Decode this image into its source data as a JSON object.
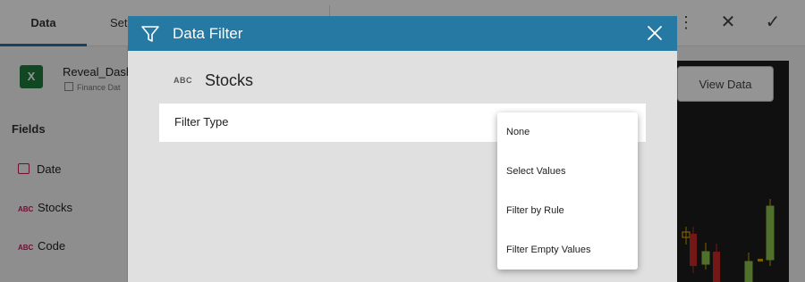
{
  "topbar": {
    "tabs": [
      {
        "label": "Data"
      },
      {
        "label": "Set"
      }
    ]
  },
  "datasource": {
    "name": "Reveal_Dasht",
    "subtitle": "Finance Dat",
    "icon": "excel-icon"
  },
  "fields": {
    "title": "Fields",
    "items": [
      {
        "type_tag": "",
        "label": "Date",
        "icon": "calendar-icon"
      },
      {
        "type_tag": "ABC",
        "label": "Stocks"
      },
      {
        "type_tag": "ABC",
        "label": "Code"
      }
    ]
  },
  "preview": {
    "view_data_label": "View Data"
  },
  "modal": {
    "title": "Data Filter",
    "field_type_tag": "ABC",
    "field_name": "Stocks",
    "filter_type_label": "Filter Type",
    "header_color": "#2679a3"
  },
  "menu": {
    "options": [
      {
        "label": "None"
      },
      {
        "label": "Select Values"
      },
      {
        "label": "Filter by Rule"
      },
      {
        "label": "Filter Empty Values"
      }
    ]
  },
  "colors": {
    "accent": "#2679a3",
    "type_tag": "#c2185b",
    "excel": "#1f7a3e"
  }
}
